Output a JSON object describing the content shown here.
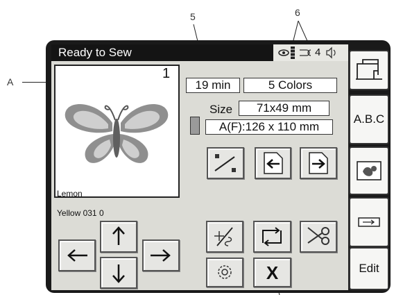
{
  "callouts": {
    "a": "A",
    "five": "5",
    "six": "6"
  },
  "screen": {
    "title": "Ready to Sew",
    "status": {
      "thread_sensor_icon": "eye-thread-icon",
      "bobbin_icon": "bobbin-icon",
      "presser_foot_code": "4",
      "sound_icon": "speaker-icon"
    },
    "preview": {
      "design_number": "1",
      "color_name_line1": "Lemon",
      "color_name_line2": "Yellow 031 0",
      "design_icon": "butterfly-design"
    },
    "info": {
      "time": "19 min",
      "colors": "5 Colors",
      "size_label": "Size",
      "size_value": "71x49 mm",
      "hoop_value": "A(F):126 x 110 mm"
    },
    "buttons": {
      "color_change": "color-change-icon",
      "page_back": "page-back-icon",
      "page_forward": "page-forward-icon",
      "jog_left": "arrow-left-icon",
      "jog_up": "arrow-up-icon",
      "jog_down": "arrow-down-icon",
      "jog_right": "arrow-right-icon",
      "trace": "trace-icon",
      "rotate": "rotate-icon",
      "cutter": "scissors-icon",
      "settings": "gear-icon",
      "cancel_label": "X"
    },
    "tabs": {
      "abc": "A.B.C",
      "edit": "Edit",
      "machine_icon": "sewing-machine-icon",
      "design_icon": "embroidery-design-icon",
      "usb_icon": "usb-icon"
    }
  }
}
